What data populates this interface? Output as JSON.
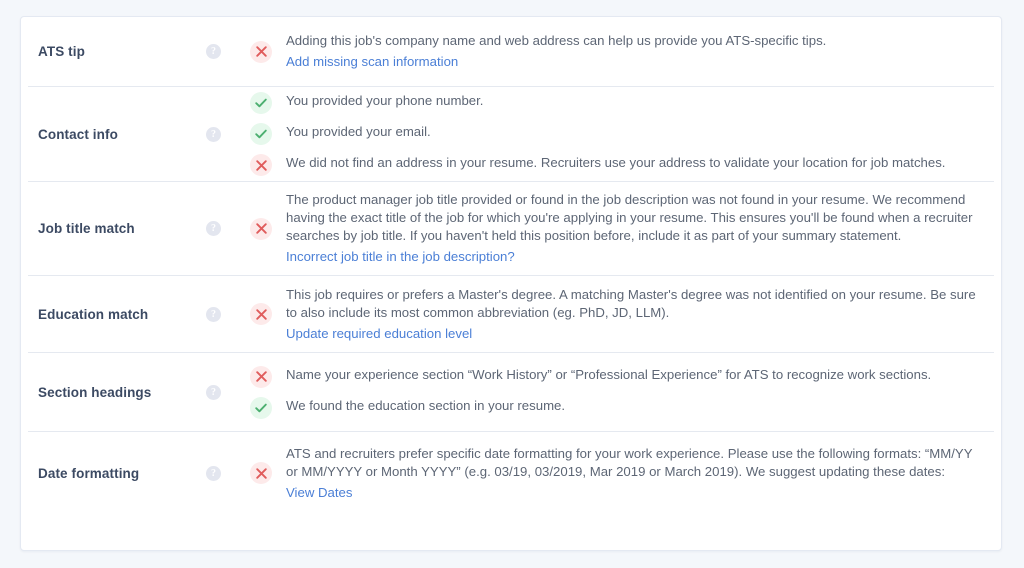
{
  "card": {
    "accent_link_color": "#4b7fd6",
    "fail_color": "#e05c5c",
    "pass_color": "#4caf70",
    "label_color": "#3c4a63",
    "text_color": "#5d6675",
    "background": "#ffffff",
    "page_background": "#f4f7fb"
  },
  "help_icon_glyph": "?",
  "rows": [
    {
      "label": "ATS tip",
      "help": "?",
      "items": [
        {
          "status": "fail",
          "text": "Adding this job's company name and web address can help us provide you ATS-specific tips.",
          "link": "Add missing scan information"
        }
      ]
    },
    {
      "label": "Contact info",
      "help": "?",
      "items": [
        {
          "status": "pass",
          "text": "You provided your phone number.",
          "link": ""
        },
        {
          "status": "pass",
          "text": "You provided your email.",
          "link": ""
        },
        {
          "status": "fail",
          "text": "We did not find an address in your resume. Recruiters use your address to validate your location for job matches.",
          "link": ""
        }
      ]
    },
    {
      "label": "Job title match",
      "help": "?",
      "items": [
        {
          "status": "fail",
          "text": "The product manager job title provided or found in the job description was not found in your resume. We recommend having the exact title of the job for which you're applying in your resume. This ensures you'll be found when a recruiter searches by job title. If you haven't held this position before, include it as part of your summary statement.",
          "link": "Incorrect job title in the job description?"
        }
      ]
    },
    {
      "label": "Education match",
      "help": "?",
      "items": [
        {
          "status": "fail",
          "text": "This job requires or prefers a Master's degree. A matching Master's degree was not identified on your resume. Be sure to also include its most common abbreviation (eg. PhD, JD, LLM).",
          "link": "Update required education level"
        }
      ]
    },
    {
      "label": "Section headings",
      "help": "?",
      "items": [
        {
          "status": "fail",
          "text": "Name your experience section “Work History” or “Professional Experience” for ATS to recognize work sections.",
          "link": ""
        },
        {
          "status": "pass",
          "text": "We found the education section in your resume.",
          "link": ""
        }
      ]
    },
    {
      "label": "Date formatting",
      "help": "?",
      "items": [
        {
          "status": "fail",
          "text": "ATS and recruiters prefer specific date formatting for your work experience. Please use the following formats: “MM/YY or MM/YYYY or Month YYYY” (e.g. 03/19, 03/2019, Mar 2019 or March 2019). We suggest updating these dates:",
          "link": "View Dates"
        }
      ]
    }
  ]
}
